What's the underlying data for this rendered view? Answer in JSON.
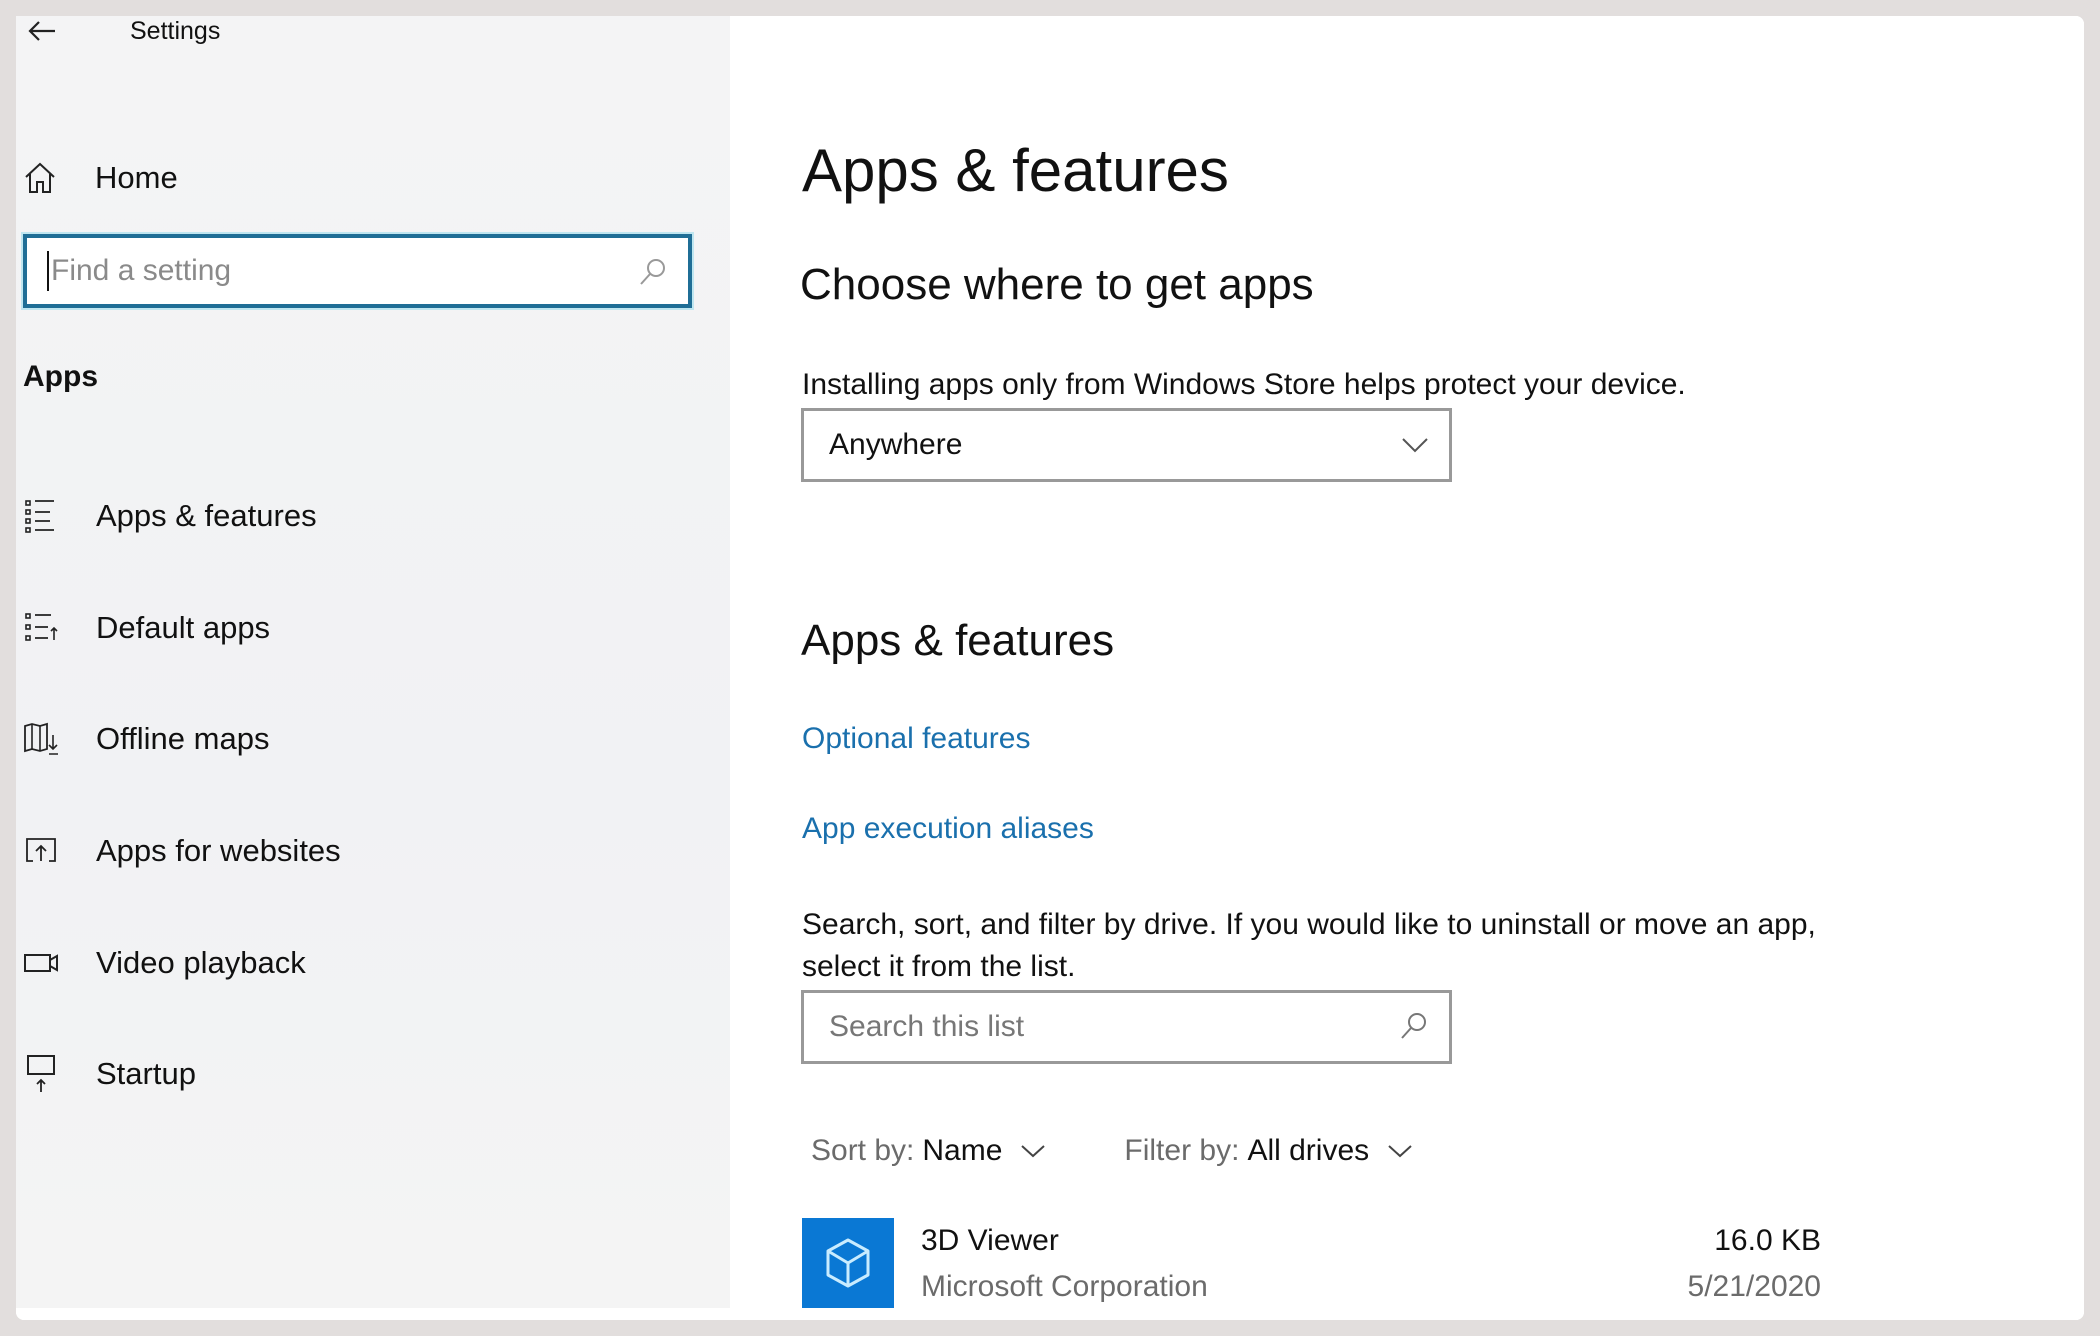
{
  "window": {
    "title": "Settings",
    "back_icon": "back-arrow-icon"
  },
  "sidebar": {
    "home": {
      "label": "Home",
      "icon": "home-icon"
    },
    "search": {
      "placeholder": "Find a setting",
      "value": "",
      "icon": "search-icon"
    },
    "section_label": "Apps",
    "items": [
      {
        "label": "Apps & features",
        "icon": "apps-features-list-icon",
        "selected": true
      },
      {
        "label": "Default apps",
        "icon": "default-apps-icon",
        "selected": false
      },
      {
        "label": "Offline maps",
        "icon": "offline-maps-icon",
        "selected": false
      },
      {
        "label": "Apps for websites",
        "icon": "apps-for-websites-icon",
        "selected": false
      },
      {
        "label": "Video playback",
        "icon": "video-camera-icon",
        "selected": false
      },
      {
        "label": "Startup",
        "icon": "startup-icon",
        "selected": false
      }
    ]
  },
  "main": {
    "page_title": "Apps & features",
    "choose_heading": "Choose where to get apps",
    "choose_description": "Installing apps only from Windows Store helps protect your device.",
    "source_dropdown": {
      "selected": "Anywhere",
      "icon": "chevron-down-icon"
    },
    "section_heading": "Apps & features",
    "links": {
      "optional_features": "Optional features",
      "execution_aliases": "App execution aliases"
    },
    "list_description": "Search, sort, and filter by drive. If you would like to uninstall or move an app, select it from the list.",
    "list_search": {
      "placeholder": "Search this list",
      "value": "",
      "icon": "search-icon"
    },
    "sort": {
      "label": "Sort by:",
      "value": "Name"
    },
    "filter": {
      "label": "Filter by:",
      "value": "All drives"
    },
    "apps": [
      {
        "name": "3D Viewer",
        "publisher": "Microsoft Corporation",
        "size": "16.0 KB",
        "date": "5/21/2020",
        "icon": "3d-cube-icon",
        "tile_color": "#0a78d4"
      }
    ]
  },
  "colors": {
    "accent": "#0a78d4",
    "link": "#1a70ad",
    "focus_border": "#1f6e96",
    "sidebar_bg": "#f3f3f4",
    "frame": "#e2dedd"
  }
}
